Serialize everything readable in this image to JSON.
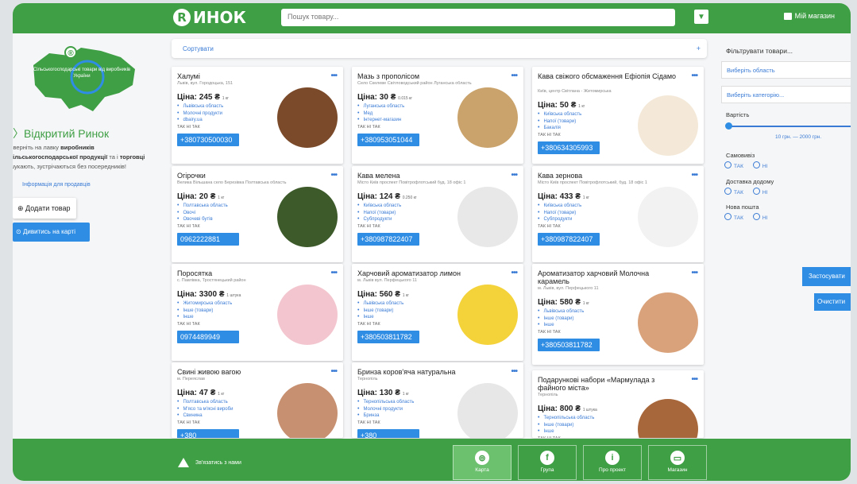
{
  "header": {
    "logo_letter": "R",
    "logo_text": "ИНОК",
    "search_placeholder": "Пошук товару...",
    "myshop": "Мій магазин"
  },
  "left": {
    "map_text": "Сільськогосподарські товари від виробників України",
    "title": "Відкритий Ринок",
    "desc_a": "Зверніть на лавку",
    "desc_b": "виробників",
    "desc_c": "сільськогосподарської продукції",
    "desc_d": "та і",
    "desc_e": "торговці",
    "desc_f": "шукають, зустрічаються без посередників!",
    "link": "Інформація для продавців",
    "add_btn": "Додати товар",
    "map_btn": "Дивитись на карті"
  },
  "sort": {
    "label": "Сортувати",
    "plus": "+"
  },
  "cards": [
    {
      "title": "Халумі",
      "addr": "Львів, вул. Городоцька, 151",
      "price": "Ціна: 245 ₴",
      "unit": "1 кг",
      "m1": "Львівська область",
      "m2": "Молочні продукти",
      "m3": "dbairy.ua",
      "del": "ТАК НІ ТАК",
      "phone": "+380730500030"
    },
    {
      "title": "Мазь з прополісом",
      "addr": "Село Скелеве Світловодський район Луганська область",
      "price": "Ціна: 30 ₴",
      "unit": "0.015 кг",
      "m1": "Луганська область",
      "m2": "Мед",
      "m3": "Інтернет-магазин",
      "del": "ТАК НІ ТАК",
      "phone": "+380953051044"
    },
    {
      "title": "Кава свіжого обсмаження Ефіопія Сідамо",
      "addr": "Київ, центр Світлана - Житомирська",
      "price": "Ціна: 50 ₴",
      "unit": "1 кг",
      "m1": "Київська область",
      "m2": "Напої (товари)",
      "m3": "Бакалія",
      "del": "ТАК НІ ТАК",
      "phone": "+380634305993"
    },
    {
      "title": "Огірочки",
      "addr": "Велика Вільшана село Березівка Полтавська область",
      "price": "Ціна: 20 ₴",
      "unit": "1 кг",
      "m1": "Полтавська область",
      "m2": "Овочі",
      "m3": "Овочеві бутів",
      "del": "ТАК НІ ТАК",
      "phone": "0962222881"
    },
    {
      "title": "Кава мелена",
      "addr": "Місто Київ проспект Повітрофлотський буд. 18 офіс 1",
      "price": "Ціна: 124 ₴",
      "unit": "0.250 кг",
      "m1": "Київська область",
      "m2": "Напої (товари)",
      "m3": "Субпродукти",
      "del": "ТАК НІ ТАК",
      "phone": "+380987822407"
    },
    {
      "title": "Кава зернова",
      "addr": "Місто Київ проспект Повітрофлотський, буд. 18 офіс 1",
      "price": "Ціна: 433 ₴",
      "unit": "1 кг",
      "m1": "Київська область",
      "m2": "Напої (товари)",
      "m3": "Субпродукти",
      "del": "ТАК НІ ТАК",
      "phone": "+380987822407"
    },
    {
      "title": "Поросятка",
      "addr": "с. Павлівка, Тростянецький район",
      "price": "Ціна: 3300 ₴",
      "unit": "1 штука",
      "m1": "Житомирська область",
      "m2": "Інше (товари)",
      "m3": "Інше",
      "del": "ТАК НІ ТАК",
      "phone": "0974489949"
    },
    {
      "title": "Харчовий ароматизатор лимон",
      "addr": "м. Львів вул. Перфецького 11",
      "price": "Ціна: 560 ₴",
      "unit": "1 кг",
      "m1": "Львівська область",
      "m2": "Інше (товари)",
      "m3": "Інше",
      "del": "ТАК НІ ТАК",
      "phone": "+380503811782"
    },
    {
      "title": "Ароматизатор харчовий Молочна карамель",
      "addr": "м. Львів, вул. Перфецького 11",
      "price": "Ціна: 580 ₴",
      "unit": "1 кг",
      "m1": "Львівська область",
      "m2": "Інше (товари)",
      "m3": "Інше",
      "del": "ТАК НІ ТАК",
      "phone": "+380503811782"
    },
    {
      "title": "Свині живою вагою",
      "addr": "м. Переяслав",
      "price": "Ціна: 47 ₴",
      "unit": "1 кг",
      "m1": "Полтавська область",
      "m2": "М'ясо та м'ясні вироби",
      "m3": "Свинина",
      "del": "ТАК НІ ТАК",
      "phone": "+380"
    },
    {
      "title": "Бринза коров'яча натуральна",
      "addr": "Тернопіль",
      "price": "Ціна: 130 ₴",
      "unit": "1 кг",
      "m1": "Тернопільська область",
      "m2": "Молочні продукти",
      "m3": "Бринза",
      "del": "ТАК НІ ТАК",
      "phone": "+380"
    },
    {
      "title": "Подарункові набори «Мармулада з файного міста»",
      "addr": "Тернопіль",
      "price": "Ціна: 800 ₴",
      "unit": "1 штука",
      "m1": "Тернопільська область",
      "m2": "Інше (товари)",
      "m3": "Інше",
      "del": "ТАК НІ ТАК",
      "phone": "+380"
    }
  ],
  "filter": {
    "title": "Фільтрувати товари...",
    "region": "Виберіть область",
    "category": "Виберіть категорію...",
    "price_label": "Вартість",
    "range": "10 грн. — 2000 грн.",
    "self_label": "Самовивіз",
    "home_label": "Доставка додому",
    "post_label": "Нова пошта",
    "yes": "ТАК",
    "no": "НІ",
    "apply": "Застосувати",
    "clear": "Очистити"
  },
  "footer": {
    "warn": "Зв'язатись з нами",
    "b1": "Карта",
    "b2": "Група",
    "b3": "Про проект",
    "b4": "Магазин"
  }
}
